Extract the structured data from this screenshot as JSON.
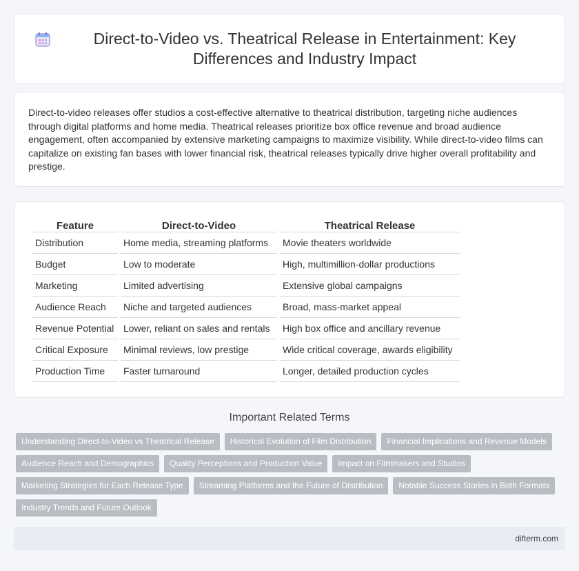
{
  "header": {
    "title": "Direct-to-Video vs. Theatrical Release in Entertainment: Key Differences and Industry Impact",
    "icon": "calendar-icon"
  },
  "intro": {
    "text": "Direct-to-video releases offer studios a cost-effective alternative to theatrical distribution, targeting niche audiences through digital platforms and home media. Theatrical releases prioritize box office revenue and broad audience engagement, often accompanied by extensive marketing campaigns to maximize visibility. While direct-to-video films can capitalize on existing fan bases with lower financial risk, theatrical releases typically drive higher overall profitability and prestige."
  },
  "table": {
    "headers": [
      "Feature",
      "Direct-to-Video",
      "Theatrical Release"
    ],
    "rows": [
      [
        "Distribution",
        "Home media, streaming platforms",
        "Movie theaters worldwide"
      ],
      [
        "Budget",
        "Low to moderate",
        "High, multimillion-dollar productions"
      ],
      [
        "Marketing",
        "Limited advertising",
        "Extensive global campaigns"
      ],
      [
        "Audience Reach",
        "Niche and targeted audiences",
        "Broad, mass-market appeal"
      ],
      [
        "Revenue Potential",
        "Lower, reliant on sales and rentals",
        "High box office and ancillary revenue"
      ],
      [
        "Critical Exposure",
        "Minimal reviews, low prestige",
        "Wide critical coverage, awards eligibility"
      ],
      [
        "Production Time",
        "Faster turnaround",
        "Longer, detailed production cycles"
      ]
    ]
  },
  "related": {
    "heading": "Important Related Terms",
    "tags": [
      "Understanding Direct-to-Video vs Theatrical Release",
      "Historical Evolution of Film Distribution",
      "Financial Implications and Revenue Models",
      "Audience Reach and Demographics",
      "Quality Perceptions and Production Value",
      "Impact on Filmmakers and Studios",
      "Marketing Strategies for Each Release Type",
      "Streaming Platforms and the Future of Distribution",
      "Notable Success Stories in Both Formats",
      "Industry Trends and Future Outlook"
    ]
  },
  "footer": {
    "site": "difterm.com"
  },
  "colors": {
    "tag_bg": "#b9bdc3",
    "footer_bg": "#e8edf5",
    "page_bg": "#f4f6f9"
  }
}
